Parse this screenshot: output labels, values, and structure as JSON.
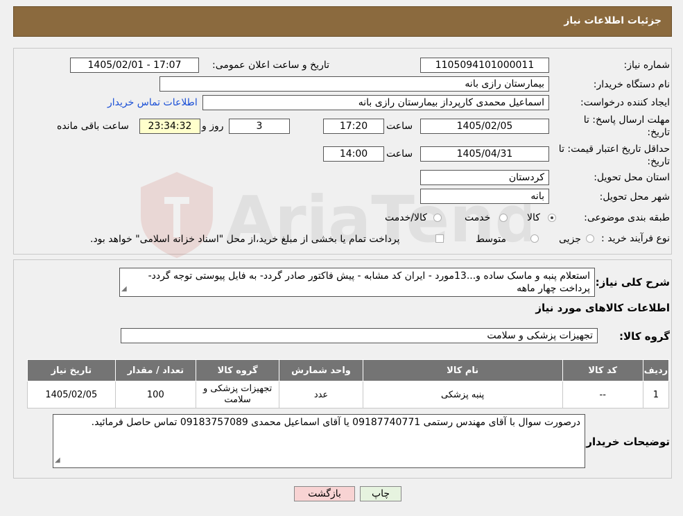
{
  "header": {
    "title": "جزئیات اطلاعات نیاز"
  },
  "labels": {
    "need_number": "شماره نیاز:",
    "announce_datetime": "تاریخ و ساعت اعلان عمومی:",
    "buyer_org": "نام دستگاه خریدار:",
    "requester": "ایجاد کننده درخواست:",
    "contact_link": "اطلاعات تماس خریدار",
    "deadline_line1": "مهلت ارسال پاسخ: تا",
    "deadline_line2": "تاریخ:",
    "price_valid_line1": "حداقل تاریخ اعتبار قیمت: تا",
    "price_valid_line2": "تاریخ:",
    "time_word": "ساعت",
    "day_and": "روز و",
    "remaining": "ساعت باقی مانده",
    "province": "استان محل تحویل:",
    "city": "شهر محل تحویل:",
    "category": "طبقه بندی موضوعی:",
    "purchase_process": "نوع فرآیند خرید :",
    "description": "شرح کلی نیاز:",
    "goods_info": "اطلاعات کالاهای مورد نیاز",
    "goods_group": "گروه کالا:",
    "buyer_notes": "توضیحات خریدار:"
  },
  "fields": {
    "need_number": "1105094101000011",
    "announce_datetime": "1405/02/01 - 17:07",
    "buyer_org": "بیمارستان رازی بانه",
    "requester": "اسماعیل محمدی کارپرداز بیمارستان رازی بانه",
    "deadline_date": "1405/02/05",
    "deadline_time": "17:20",
    "days": "3",
    "remaining_time": "23:34:32",
    "price_valid_date": "1405/04/31",
    "price_valid_time": "14:00",
    "province": "کردستان",
    "city": "بانه",
    "goods_group": "تجهیزات پزشکی و سلامت"
  },
  "category_options": [
    "کالا",
    "خدمت",
    "کالا/خدمت"
  ],
  "category_selected": "کالا",
  "process_options": [
    "جزیی",
    "متوسط"
  ],
  "process_note": "پرداخت تمام یا بخشی از مبلغ خرید،از محل \"اسناد خزانه اسلامی\" خواهد بود.",
  "description_text": "استعلام پنبه و ماسک ساده و...13مورد - ایران کد مشابه - پیش فاکتور صادر گردد- به فایل پیوستی توجه گردد- پرداخت چهار ماهه",
  "table": {
    "headers": [
      "ردیف",
      "کد کالا",
      "نام کالا",
      "واحد شمارش",
      "گروه کالا",
      "تعداد / مقدار",
      "تاریخ نیاز"
    ],
    "rows": [
      [
        "1",
        "--",
        "پنبه پزشکی",
        "عدد",
        "تجهیزات پزشکی و سلامت",
        "100",
        "1405/02/05"
      ]
    ]
  },
  "notes_text": "درصورت سوال با آقای مهندس رستمی 09187740771 یا آقای اسماعیل محمدی 09183757089 تماس حاصل فرمائید.",
  "buttons": {
    "print": "چاپ",
    "back": "بازگشت"
  },
  "colors": {
    "header_bg": "#8b6a3e",
    "table_header_bg": "#747474",
    "link": "#1a4fd6",
    "back_button_bg": "#f8d3d3",
    "print_button_bg": "#e6f3df"
  }
}
